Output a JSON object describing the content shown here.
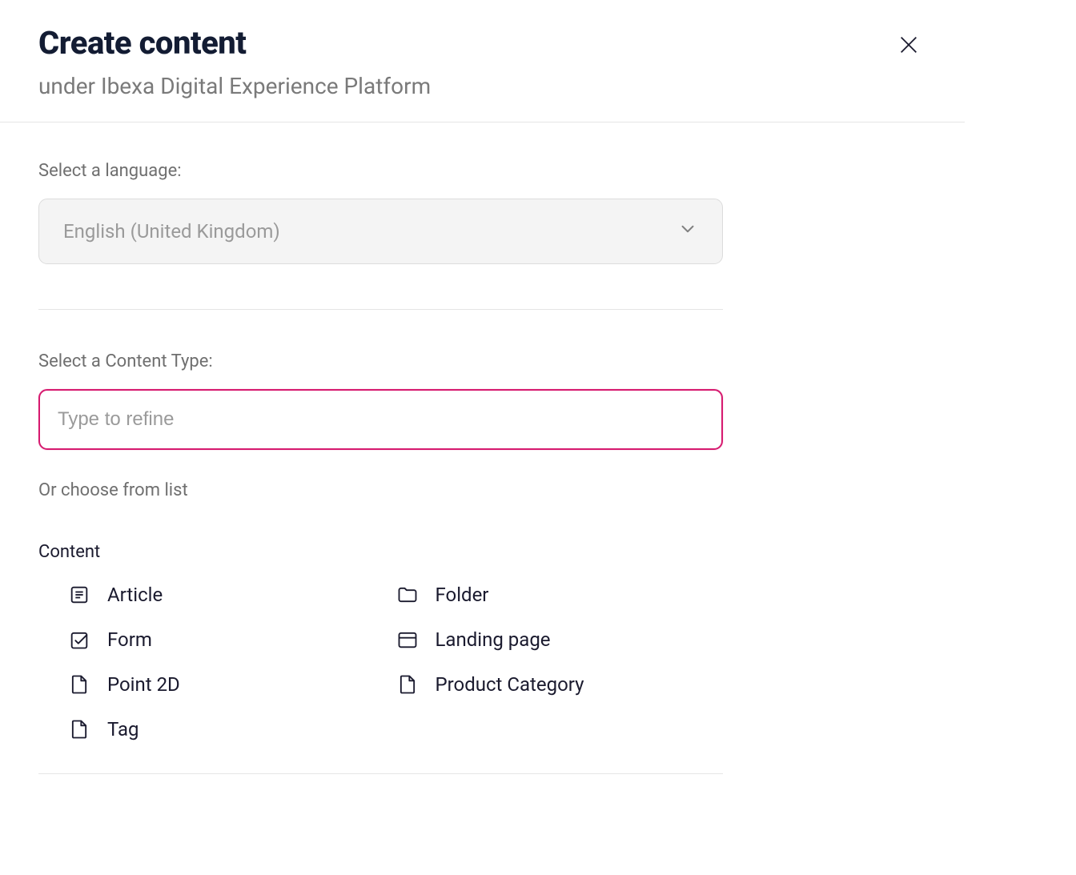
{
  "header": {
    "title": "Create content",
    "subtitle": "under Ibexa Digital Experience Platform"
  },
  "language": {
    "label": "Select a language:",
    "selected": "English (United Kingdom)"
  },
  "contentType": {
    "label": "Select a Content Type:",
    "placeholder": "Type to refine",
    "orChoose": "Or choose from list",
    "groupTitle": "Content",
    "items": [
      {
        "label": "Article",
        "icon": "article"
      },
      {
        "label": "Folder",
        "icon": "folder"
      },
      {
        "label": "Form",
        "icon": "form"
      },
      {
        "label": "Landing page",
        "icon": "landing"
      },
      {
        "label": "Point 2D",
        "icon": "file"
      },
      {
        "label": "Product Category",
        "icon": "file"
      },
      {
        "label": "Tag",
        "icon": "file"
      }
    ]
  }
}
